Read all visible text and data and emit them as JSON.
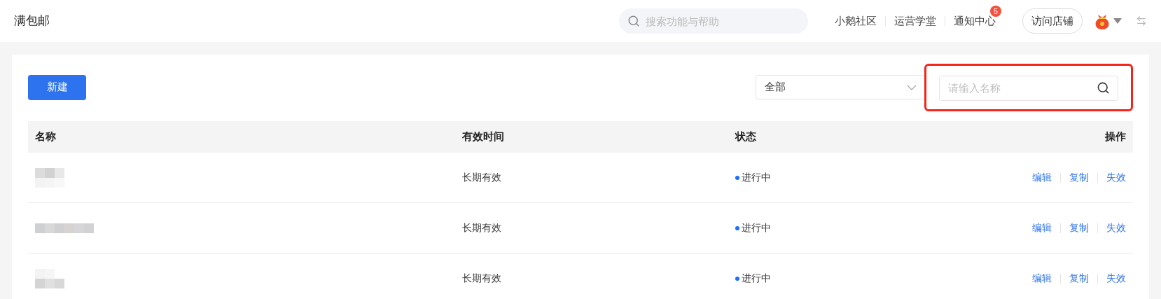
{
  "header": {
    "title": "满包邮",
    "search": {
      "placeholder": "搜索功能与帮助"
    },
    "links": [
      {
        "label": "小鹅社区"
      },
      {
        "label": "运营学堂"
      },
      {
        "label": "通知中心",
        "badge": "5"
      }
    ],
    "visit_button": "访问店铺"
  },
  "toolbar": {
    "new_button": "新建",
    "filter": {
      "value": "全部"
    },
    "search": {
      "placeholder": "请输入名称",
      "highlighted": true
    }
  },
  "table": {
    "columns": [
      "名称",
      "有效时间",
      "状态",
      "操作"
    ],
    "rows": [
      {
        "name": {
          "kind": "blurred"
        },
        "validity": "长期有效",
        "status": "进行中",
        "active": true,
        "actions": [
          "编辑",
          "复制",
          "失效"
        ]
      },
      {
        "name": {
          "kind": "blurred"
        },
        "validity": "长期有效",
        "status": "进行中",
        "active": true,
        "actions": [
          "编辑",
          "复制",
          "失效"
        ]
      },
      {
        "name": {
          "kind": "blurred"
        },
        "validity": "长期有效",
        "status": "进行中",
        "active": true,
        "actions": [
          "编辑",
          "复制",
          "失效"
        ]
      }
    ]
  }
}
